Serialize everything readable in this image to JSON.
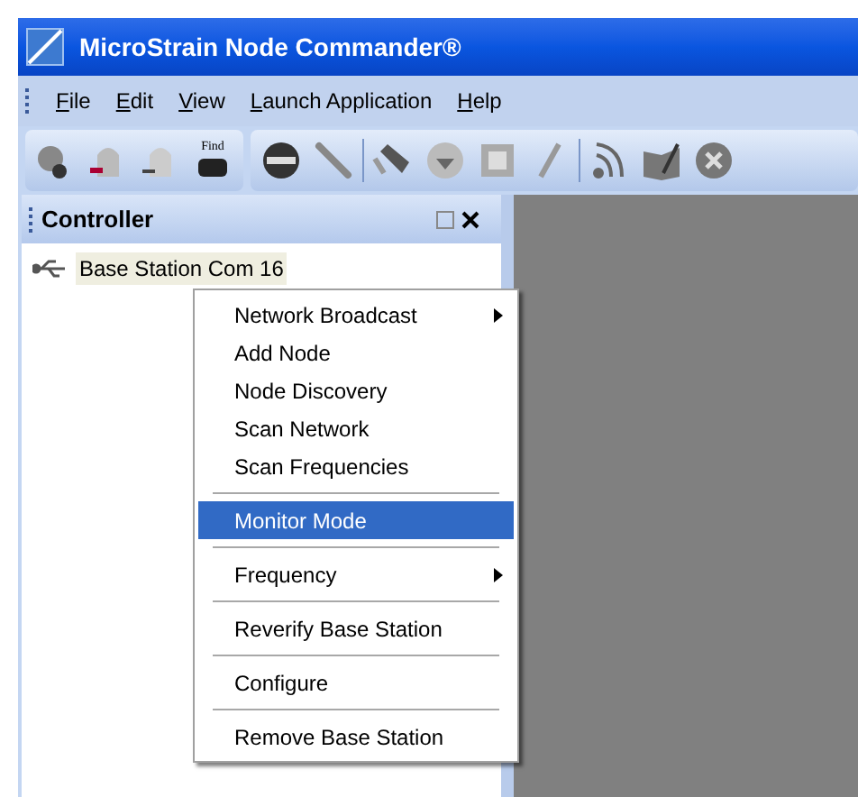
{
  "window": {
    "title": "MicroStrain Node Commander®"
  },
  "menu_bar": [
    {
      "access_key": "F",
      "rest": "ile"
    },
    {
      "access_key": "E",
      "rest": "dit"
    },
    {
      "access_key": "V",
      "rest": "iew"
    },
    {
      "access_key": "L",
      "rest": "aunch Application"
    },
    {
      "access_key": "H",
      "rest": "elp"
    }
  ],
  "toolbar": {
    "find_label": "Find"
  },
  "controller": {
    "title": "Controller",
    "tree": [
      {
        "label": "Base Station Com 16"
      }
    ]
  },
  "context_menu": [
    {
      "kind": "item",
      "label": "Network Broadcast",
      "submenu": true,
      "selected": false
    },
    {
      "kind": "item",
      "label": "Add Node",
      "submenu": false,
      "selected": false
    },
    {
      "kind": "item",
      "label": "Node Discovery",
      "submenu": false,
      "selected": false
    },
    {
      "kind": "item",
      "label": "Scan Network",
      "submenu": false,
      "selected": false
    },
    {
      "kind": "item",
      "label": "Scan Frequencies",
      "submenu": false,
      "selected": false
    },
    {
      "kind": "separator"
    },
    {
      "kind": "item",
      "label": "Monitor Mode",
      "submenu": false,
      "selected": true
    },
    {
      "kind": "separator"
    },
    {
      "kind": "item",
      "label": "Frequency",
      "submenu": true,
      "selected": false
    },
    {
      "kind": "separator"
    },
    {
      "kind": "item",
      "label": "Reverify Base Station",
      "submenu": false,
      "selected": false
    },
    {
      "kind": "separator"
    },
    {
      "kind": "item",
      "label": "Configure",
      "submenu": false,
      "selected": false
    },
    {
      "kind": "separator"
    },
    {
      "kind": "item",
      "label": "Remove Base Station",
      "submenu": false,
      "selected": false
    }
  ]
}
